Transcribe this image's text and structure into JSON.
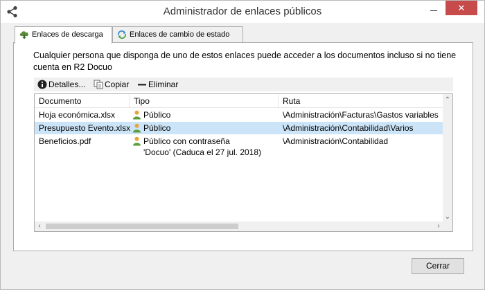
{
  "window": {
    "title": "Administrador de enlaces públicos",
    "close_glyph": "✕"
  },
  "tabs": [
    {
      "label": "Enlaces de descarga",
      "icon": "cloud-download-icon",
      "active": true
    },
    {
      "label": "Enlaces de cambio de estado",
      "icon": "status-sync-icon",
      "active": false
    }
  ],
  "panel": {
    "description": "Cualquier persona que disponga de uno de estos enlaces puede acceder a los documentos incluso si no tiene cuenta en R2 Docuo"
  },
  "toolbar": {
    "details_label": "Detalles...",
    "copy_label": "Copiar",
    "delete_label": "Eliminar"
  },
  "table": {
    "columns": [
      "Documento",
      "Tipo",
      "Ruta"
    ],
    "rows": [
      {
        "documento": "Hoja económica.xlsx",
        "tipo": "Público",
        "tipo2": "",
        "ruta": "\\Administración\\Facturas\\Gastos variables",
        "selected": false
      },
      {
        "documento": "Presupuesto Evento.xlsx",
        "tipo": "Público",
        "tipo2": "",
        "ruta": "\\Administración\\Contabilidad\\Varios",
        "selected": true
      },
      {
        "documento": "Beneficios.pdf",
        "tipo": "Público con contraseña",
        "tipo2": "'Docuo' (Caduca el 27 jul. 2018)",
        "ruta": "\\Administración\\Contabilidad",
        "selected": false
      }
    ]
  },
  "footer": {
    "close_label": "Cerrar"
  },
  "colors": {
    "selection": "#cce4f7",
    "close_red": "#c84b4b",
    "accent_orange": "#e8a33a"
  }
}
